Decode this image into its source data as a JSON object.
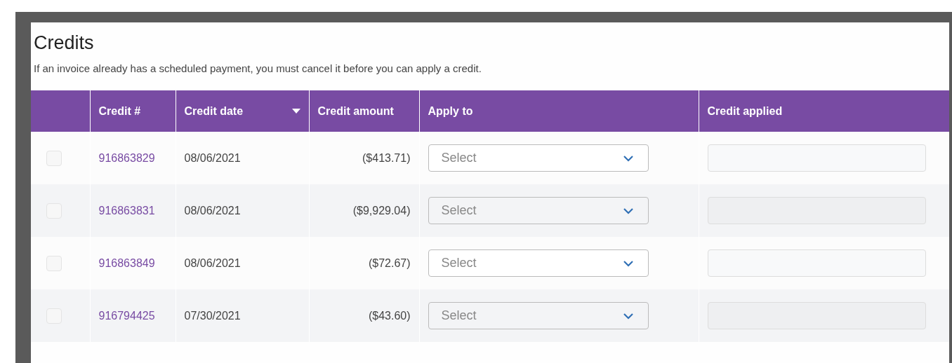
{
  "title": "Credits",
  "note": "If an invoice already has a scheduled payment, you must cancel it before you can apply a credit.",
  "table": {
    "columns": [
      {},
      {
        "label": "Credit #"
      },
      {
        "label": "Credit date",
        "sorted": true
      },
      {
        "label": "Credit amount"
      },
      {
        "label": "Apply to"
      },
      {
        "label": "Credit applied"
      }
    ],
    "rows": [
      {
        "checked": false,
        "credit": "916863829",
        "date": "08/06/2021",
        "amount": "($413.71)",
        "apply_placeholder": "Select"
      },
      {
        "checked": false,
        "credit": "916863831",
        "date": "08/06/2021",
        "amount": "($9,929.04)",
        "apply_placeholder": "Select"
      },
      {
        "checked": false,
        "credit": "916863849",
        "date": "08/06/2021",
        "amount": "($72.67)",
        "apply_placeholder": "Select"
      },
      {
        "checked": false,
        "credit": "916794425",
        "date": "07/30/2021",
        "amount": "($43.60)",
        "apply_placeholder": "Select"
      }
    ]
  }
}
